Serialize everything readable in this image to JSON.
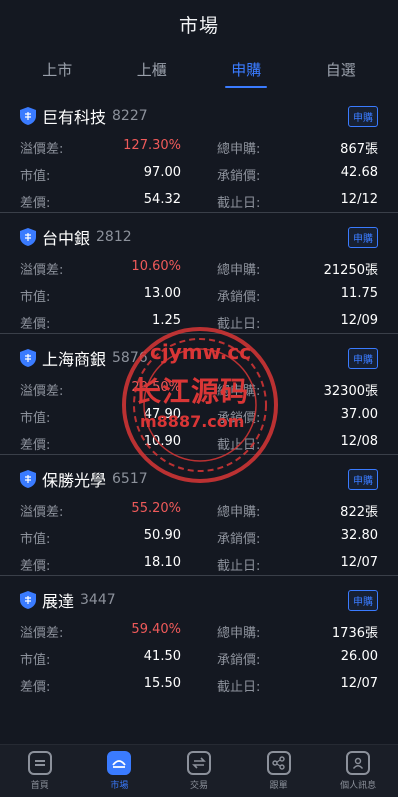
{
  "header": {
    "title": "市場"
  },
  "tabs": [
    {
      "label": "上市",
      "active": false
    },
    {
      "label": "上櫃",
      "active": false
    },
    {
      "label": "申購",
      "active": true
    },
    {
      "label": "自選",
      "active": false
    }
  ],
  "labels": {
    "premium": "溢價差:",
    "total": "總申購:",
    "market": "市值:",
    "underwrite": "承銷價:",
    "spread": "差價:",
    "deadline": "截止日:"
  },
  "stocks": [
    {
      "name": "巨有科技",
      "code": "8227",
      "badge": "申購",
      "premium": "127.30%",
      "total": "867張",
      "market": "97.00",
      "underwrite": "42.68",
      "spread": "54.32",
      "deadline": "12/12"
    },
    {
      "name": "台中銀",
      "code": "2812",
      "badge": "申購",
      "premium": "10.60%",
      "total": "21250張",
      "market": "13.00",
      "underwrite": "11.75",
      "spread": "1.25",
      "deadline": "12/09"
    },
    {
      "name": "上海商銀",
      "code": "5876",
      "badge": "申購",
      "premium": "29.50%",
      "total": "32300張",
      "market": "47.90",
      "underwrite": "37.00",
      "spread": "10.90",
      "deadline": "12/08"
    },
    {
      "name": "保勝光學",
      "code": "6517",
      "badge": "申購",
      "premium": "55.20%",
      "total": "822張",
      "market": "50.90",
      "underwrite": "32.80",
      "spread": "18.10",
      "deadline": "12/07"
    },
    {
      "name": "展達",
      "code": "3447",
      "badge": "申購",
      "premium": "59.40%",
      "total": "1736張",
      "market": "41.50",
      "underwrite": "26.00",
      "spread": "15.50",
      "deadline": "12/07"
    }
  ],
  "watermark": {
    "line1": "cjymw.cc",
    "line2": "长江源码",
    "line3": "m8887.com"
  },
  "nav": [
    {
      "label": "首頁",
      "icon": "home-icon",
      "active": false
    },
    {
      "label": "市場",
      "icon": "market-icon",
      "active": true
    },
    {
      "label": "交易",
      "icon": "trade-icon",
      "active": false
    },
    {
      "label": "跟單",
      "icon": "share-icon",
      "active": false
    },
    {
      "label": "個人訊息",
      "icon": "user-icon",
      "active": false
    }
  ],
  "colors": {
    "accent": "#3a7bff",
    "up": "#ef5a5a",
    "background": "#141821"
  }
}
